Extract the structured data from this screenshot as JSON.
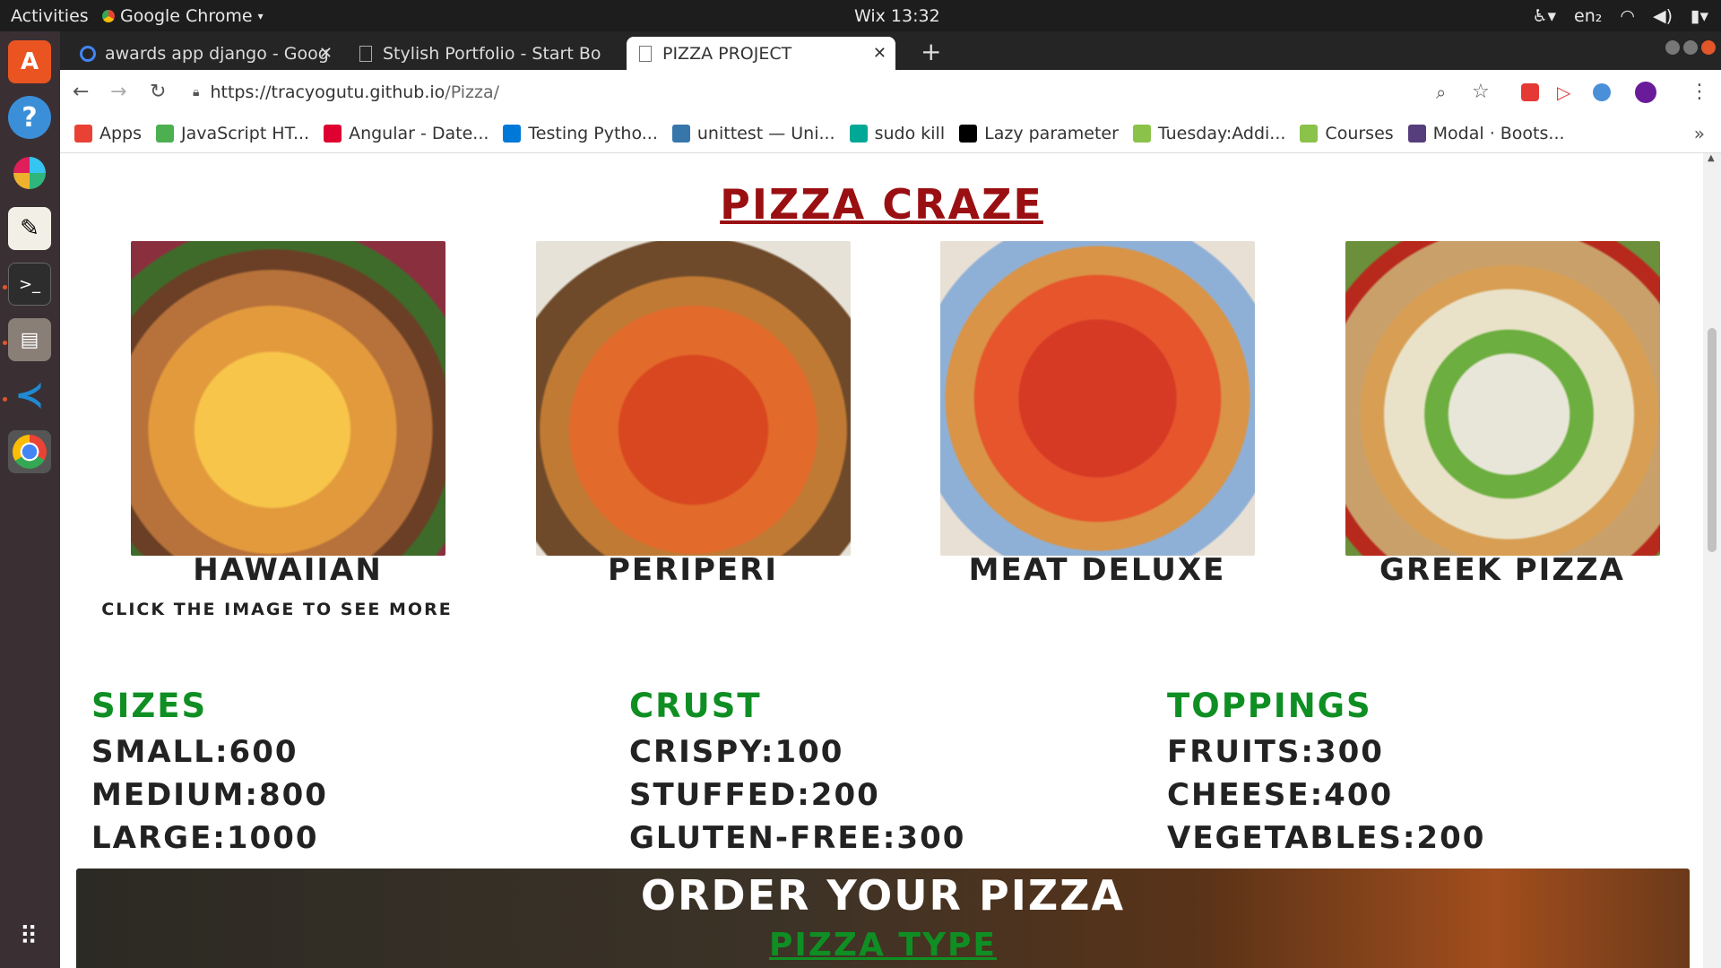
{
  "topbar": {
    "activities": "Activities",
    "app": "Google Chrome",
    "clock": "Wix 13:32",
    "lang": "en₂"
  },
  "tabs": [
    {
      "label": "awards app django - Goog"
    },
    {
      "label": "Stylish Portfolio - Start Bo"
    },
    {
      "label": "PIZZA PROJECT"
    }
  ],
  "omnibox": {
    "url_host": "https://tracyogutu.github.io",
    "url_path": "/Pizza/"
  },
  "bookmarks": [
    {
      "label": "Apps",
      "icon": "apps-grid-icon",
      "color": "#e94235"
    },
    {
      "label": "JavaScript HT...",
      "icon": "w3-icon",
      "color": "#4caf50"
    },
    {
      "label": "Angular - Date...",
      "icon": "angular-icon",
      "color": "#dd0031"
    },
    {
      "label": "Testing Pytho...",
      "icon": "vscode-icon",
      "color": "#0078d7"
    },
    {
      "label": "unittest — Uni...",
      "icon": "python-icon",
      "color": "#3776ab"
    },
    {
      "label": "sudo kill",
      "icon": "gear-icon",
      "color": "#00a896"
    },
    {
      "label": "Lazy parameter",
      "icon": "medium-icon",
      "color": "#000000"
    },
    {
      "label": "Tuesday:Addi...",
      "icon": "tree-icon",
      "color": "#8bc34a"
    },
    {
      "label": "Courses",
      "icon": "tree-icon",
      "color": "#8bc34a"
    },
    {
      "label": "Modal · Boots...",
      "icon": "bootstrap-icon",
      "color": "#563d7c"
    }
  ],
  "page": {
    "brand": "PIZZA CRAZE",
    "pizzas": [
      {
        "name": "HAWAIIAN"
      },
      {
        "name": "PERIPERI"
      },
      {
        "name": "MEAT DELUXE"
      },
      {
        "name": "GREEK PIZZA"
      }
    ],
    "click_more": "CLICK THE IMAGE TO SEE MORE",
    "sizes": {
      "title": "SIZES",
      "items": [
        "SMALL:600",
        "MEDIUM:800",
        "LARGE:1000"
      ]
    },
    "crust": {
      "title": "CRUST",
      "items": [
        "CRISPY:100",
        "STUFFED:200",
        "GLUTEN-FREE:300"
      ]
    },
    "toppings": {
      "title": "TOPPINGS",
      "items": [
        "FRUITS:300",
        "CHEESE:400",
        "VEGETABLES:200"
      ]
    },
    "order_title": "ORDER YOUR PIZZA",
    "pizza_type": "PIZZA TYPE"
  },
  "colors": {
    "brand": "#9a0f12",
    "section": "#0f8f23"
  }
}
